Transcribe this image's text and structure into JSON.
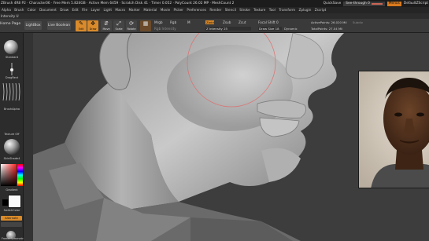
{
  "titlebar": {
    "left_text": "ZBrush 4R8 P2 · Character06 · Free Mem 5.824GB · Active Mem 6459 · Scratch Disk 41 · Timer 0.052 · PolyCount 26.02 MP · MeshCount 2",
    "quicksave": "QuickSave",
    "see_through": "See-through  0",
    "menus": "Menus",
    "default": "DefaultZScript"
  },
  "menubar": {
    "items": [
      "Alpha",
      "Brush",
      "Color",
      "Document",
      "Draw",
      "Edit",
      "File",
      "Layer",
      "Light",
      "Macro",
      "Marker",
      "Material",
      "Movie",
      "Picker",
      "Preferences",
      "Render",
      "Stencil",
      "Stroke",
      "Texture",
      "Tool",
      "Transform",
      "Zplugin",
      "Zscript"
    ]
  },
  "subrow": {
    "text": "Intensity  U"
  },
  "shelf": {
    "home_label": "Home Page",
    "lightbox_label": "LightBox",
    "live_boolean_label": "Live Boolean",
    "tools": [
      {
        "glyph": "✎",
        "label": "Edit",
        "icon": "edit-icon"
      },
      {
        "glyph": "✥",
        "label": "Draw",
        "icon": "draw-icon"
      },
      {
        "glyph": "⇵",
        "label": "Move",
        "icon": "move-icon"
      },
      {
        "glyph": "⤢",
        "label": "Scale",
        "icon": "scale-icon"
      },
      {
        "glyph": "⟳",
        "label": "Rotate",
        "icon": "rotate-icon"
      }
    ],
    "mrgb": "Mrgb",
    "rgb": "Rgb",
    "m": "M",
    "rgb_intensity": "Rgb Intensity",
    "zadd": "Zadd",
    "zsub": "Zsub",
    "zcut": "Zcut",
    "z_intensity": "Z Intensity 25",
    "focal_shift": "Focal Shift 0",
    "draw_size": "Draw Size 18",
    "dynamic": "Dynamic",
    "active_points": "ActivePoints: 26.020 Mil",
    "total_points": "TotalPoints: 27.04 Mil",
    "subdiv": "Subdiv"
  },
  "lefttray": {
    "standard": "Standard",
    "dragrect": "DragRect",
    "brushalpha": "BrushAlpha",
    "texture_off": "Texture Off",
    "matcap": "SkinShade4",
    "gradient": "Gradient",
    "switch_color": "SwitchColor",
    "alternate": "Alternate",
    "freeze_symmetry": "FreezeSymmetry"
  },
  "colors": {
    "accent": "#d98a2a",
    "panel": "#2c2c2c",
    "canvas": "#3d3d3d"
  }
}
